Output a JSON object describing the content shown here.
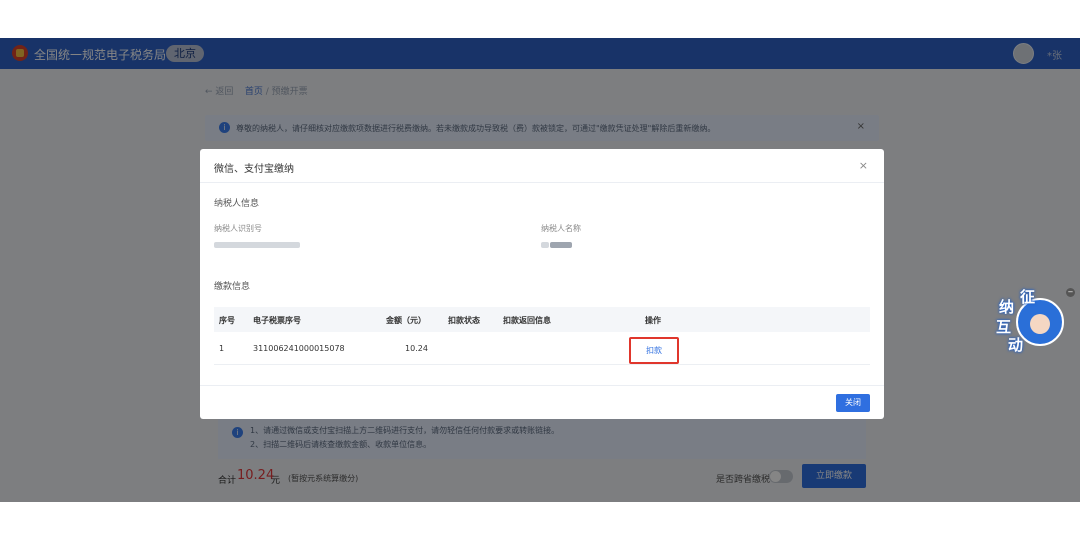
{
  "header": {
    "app_title": "全国统一规范电子税务局",
    "region": "北京",
    "user_name": "*张"
  },
  "breadcrumb": {
    "back": "← 返回",
    "home": "首页",
    "separator": "/",
    "current": "预缴开票"
  },
  "notice": {
    "text": "尊敬的纳税人，请仔细核对应缴款项数据进行税费缴纳。若未缴款成功导致税（费）款被锁定，可通过\"缴款凭证处理\"解除后重新缴纳。",
    "close": "×"
  },
  "modal": {
    "title": "微信、支付宝缴纳",
    "close_icon": "×",
    "taxpayer_section": "纳税人信息",
    "taxpayer_id_label": "纳税人识别号",
    "taxpayer_name_label": "纳税人名称",
    "payment_section": "缴款信息",
    "table": {
      "headers": [
        "序号",
        "电子税票序号",
        "金额（元）",
        "扣款状态",
        "扣款返回信息",
        "操作"
      ],
      "rows": [
        {
          "index": "1",
          "ticket_no": "311006241000015078",
          "amount": "10.24",
          "status": "",
          "return_info": "",
          "action": "扣款"
        }
      ]
    },
    "close_button": "关闭"
  },
  "tips": {
    "line1": "1、请通过微信或支付宝扫描上方二维码进行支付，请勿轻信任何付款要求或转账链接。",
    "line2": "2、扫描二维码后请核查缴款金额、收款单位信息。"
  },
  "footer": {
    "total_label": "合计",
    "total_amount": "10.24",
    "total_unit": "元",
    "total_note": "(暂按元系统算缴分)",
    "toggle_label": "是否跨省缴税",
    "pay_button": "立即缴款"
  },
  "widget": {
    "chars": [
      "征",
      "纳",
      "互",
      "动"
    ],
    "minimize": "−"
  }
}
